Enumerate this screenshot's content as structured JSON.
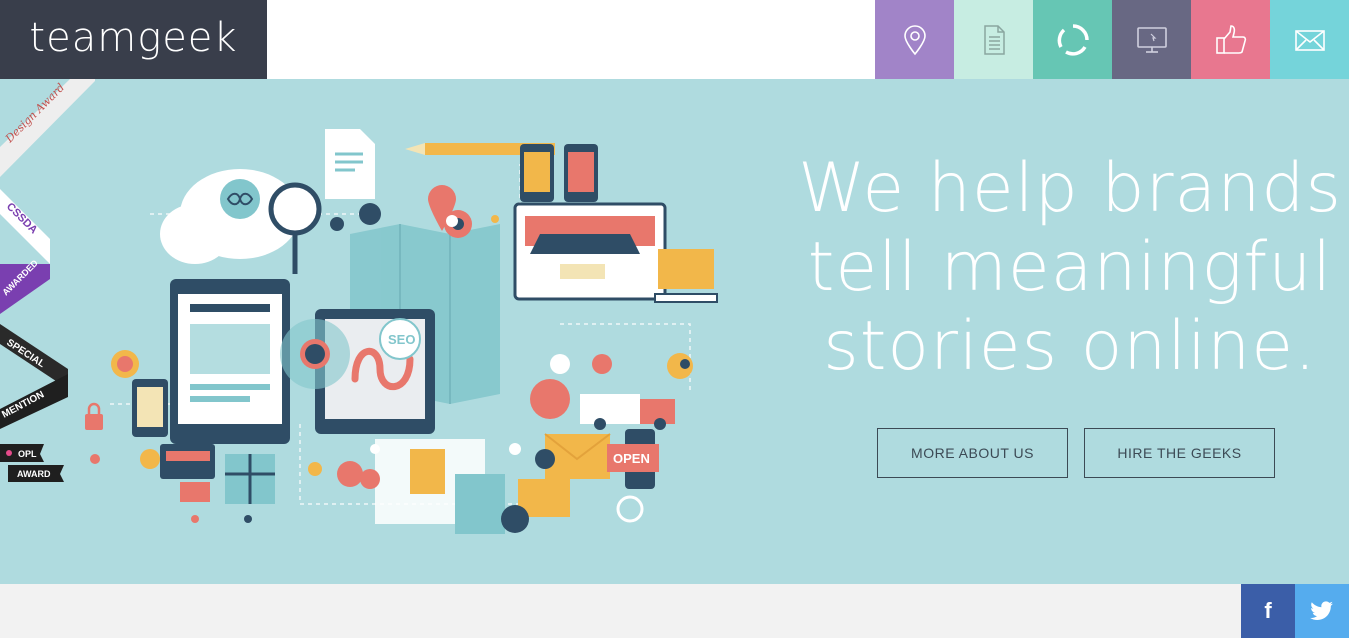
{
  "brand": {
    "logo_text": "teamgeek"
  },
  "nav": {
    "items": [
      {
        "icon": "location-pin-icon",
        "color": "#a184c8"
      },
      {
        "icon": "document-icon",
        "color": "#c7ede2"
      },
      {
        "icon": "refresh-circle-icon",
        "color": "#66c6b4"
      },
      {
        "icon": "monitor-icon",
        "color": "#686883"
      },
      {
        "icon": "thumbs-up-icon",
        "color": "#e8778f"
      },
      {
        "icon": "envelope-icon",
        "color": "#75d4da"
      }
    ]
  },
  "hero": {
    "headline_lines": [
      "We help brands",
      "tell meaningful",
      "stories online."
    ],
    "buttons": {
      "about": "MORE ABOUT US",
      "hire": "HIRE THE GEEKS"
    },
    "background": "#afdbdf"
  },
  "awards": {
    "design_award": "Design Award",
    "cssda": "CSSDA",
    "awarded": "AWARDED",
    "special": "SPECIAL",
    "mention": "MENTION",
    "opl": "OPL",
    "award": "AWARD"
  },
  "illustration": {
    "seo": "SEO",
    "open_sign": "OPEN"
  },
  "social": {
    "facebook": {
      "glyph": "f",
      "color": "#3b5ea8"
    },
    "twitter": {
      "color": "#55acee"
    }
  }
}
